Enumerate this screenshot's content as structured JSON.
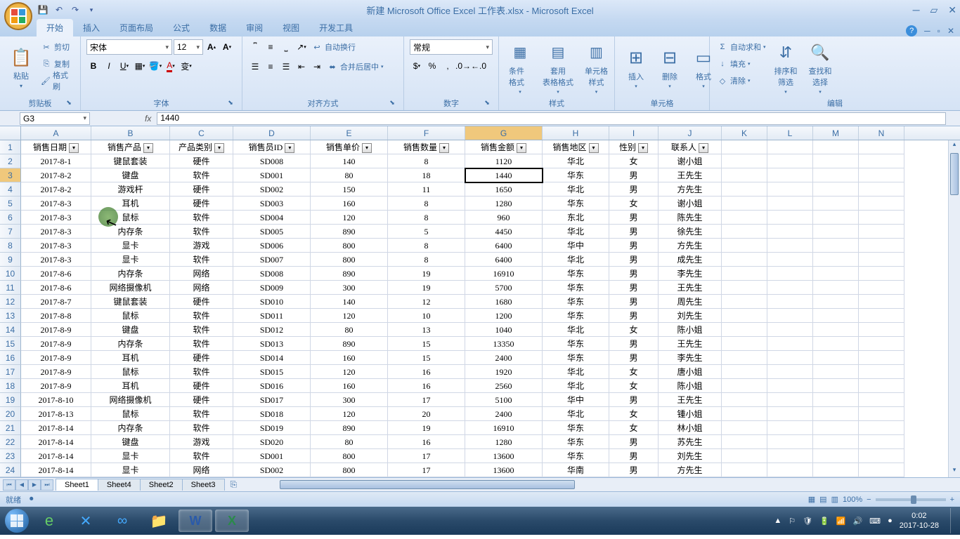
{
  "title": "新建 Microsoft Office Excel 工作表.xlsx - Microsoft Excel",
  "tabs": [
    "开始",
    "插入",
    "页面布局",
    "公式",
    "数据",
    "审阅",
    "视图",
    "开发工具"
  ],
  "activeTab": 0,
  "clipboard": {
    "label": "剪贴板",
    "paste": "粘贴",
    "cut": "剪切",
    "copy": "复制",
    "painter": "格式刷"
  },
  "font": {
    "label": "字体",
    "name": "宋体",
    "size": "12"
  },
  "align": {
    "label": "对齐方式",
    "wrap": "自动换行",
    "merge": "合并后居中"
  },
  "number": {
    "label": "数字",
    "format": "常规"
  },
  "styles": {
    "label": "样式",
    "cond": "条件格式",
    "table": "套用\n表格格式",
    "cell": "单元格\n样式"
  },
  "cells": {
    "label": "单元格",
    "insert": "插入",
    "delete": "删除",
    "format": "格式"
  },
  "editing": {
    "label": "编辑",
    "sum": "自动求和",
    "fill": "填充",
    "clear": "清除",
    "sort": "排序和\n筛选",
    "find": "查找和\n选择"
  },
  "nameBox": "G3",
  "formula": "1440",
  "columns": [
    "A",
    "B",
    "C",
    "D",
    "E",
    "F",
    "G",
    "H",
    "I",
    "J",
    "K",
    "L",
    "M",
    "N"
  ],
  "selectedCol": 6,
  "selectedRow": 3,
  "headers": [
    "销售日期",
    "销售产品",
    "产品类别",
    "销售员ID",
    "销售单价",
    "销售数量",
    "销售金额",
    "销售地区",
    "性别",
    "联系人"
  ],
  "rows": [
    [
      "2017-8-1",
      "键鼠套装",
      "硬件",
      "SD008",
      "140",
      "8",
      "1120",
      "华北",
      "女",
      "谢小姐"
    ],
    [
      "2017-8-2",
      "键盘",
      "软件",
      "SD001",
      "80",
      "18",
      "1440",
      "华东",
      "男",
      "王先生"
    ],
    [
      "2017-8-2",
      "游戏杆",
      "硬件",
      "SD002",
      "150",
      "11",
      "1650",
      "华北",
      "男",
      "方先生"
    ],
    [
      "2017-8-3",
      "耳机",
      "硬件",
      "SD003",
      "160",
      "8",
      "1280",
      "华东",
      "女",
      "谢小姐"
    ],
    [
      "2017-8-3",
      "鼠标",
      "软件",
      "SD004",
      "120",
      "8",
      "960",
      "东北",
      "男",
      "陈先生"
    ],
    [
      "2017-8-3",
      "内存条",
      "软件",
      "SD005",
      "890",
      "5",
      "4450",
      "华北",
      "男",
      "徐先生"
    ],
    [
      "2017-8-3",
      "显卡",
      "游戏",
      "SD006",
      "800",
      "8",
      "6400",
      "华中",
      "男",
      "方先生"
    ],
    [
      "2017-8-3",
      "显卡",
      "软件",
      "SD007",
      "800",
      "8",
      "6400",
      "华北",
      "男",
      "成先生"
    ],
    [
      "2017-8-6",
      "内存条",
      "网络",
      "SD008",
      "890",
      "19",
      "16910",
      "华东",
      "男",
      "李先生"
    ],
    [
      "2017-8-6",
      "网络摄像机",
      "网络",
      "SD009",
      "300",
      "19",
      "5700",
      "华东",
      "男",
      "王先生"
    ],
    [
      "2017-8-7",
      "键鼠套装",
      "硬件",
      "SD010",
      "140",
      "12",
      "1680",
      "华东",
      "男",
      "周先生"
    ],
    [
      "2017-8-8",
      "鼠标",
      "软件",
      "SD011",
      "120",
      "10",
      "1200",
      "华东",
      "男",
      "刘先生"
    ],
    [
      "2017-8-9",
      "键盘",
      "软件",
      "SD012",
      "80",
      "13",
      "1040",
      "华北",
      "女",
      "陈小姐"
    ],
    [
      "2017-8-9",
      "内存条",
      "软件",
      "SD013",
      "890",
      "15",
      "13350",
      "华东",
      "男",
      "王先生"
    ],
    [
      "2017-8-9",
      "耳机",
      "硬件",
      "SD014",
      "160",
      "15",
      "2400",
      "华东",
      "男",
      "李先生"
    ],
    [
      "2017-8-9",
      "鼠标",
      "软件",
      "SD015",
      "120",
      "16",
      "1920",
      "华北",
      "女",
      "唐小姐"
    ],
    [
      "2017-8-9",
      "耳机",
      "硬件",
      "SD016",
      "160",
      "16",
      "2560",
      "华北",
      "女",
      "陈小姐"
    ],
    [
      "2017-8-10",
      "网络摄像机",
      "硬件",
      "SD017",
      "300",
      "17",
      "5100",
      "华中",
      "男",
      "王先生"
    ],
    [
      "2017-8-13",
      "鼠标",
      "软件",
      "SD018",
      "120",
      "20",
      "2400",
      "华北",
      "女",
      "锺小姐"
    ],
    [
      "2017-8-14",
      "内存条",
      "软件",
      "SD019",
      "890",
      "19",
      "16910",
      "华东",
      "女",
      "林小姐"
    ],
    [
      "2017-8-14",
      "键盘",
      "游戏",
      "SD020",
      "80",
      "16",
      "1280",
      "华东",
      "男",
      "苏先生"
    ],
    [
      "2017-8-14",
      "显卡",
      "软件",
      "SD001",
      "800",
      "17",
      "13600",
      "华东",
      "男",
      "刘先生"
    ],
    [
      "2017-8-14",
      "显卡",
      "网络",
      "SD002",
      "800",
      "17",
      "13600",
      "华南",
      "男",
      "方先生"
    ]
  ],
  "sheets": [
    "Sheet1",
    "Sheet4",
    "Sheet2",
    "Sheet3"
  ],
  "activeSheet": 0,
  "status": "就绪",
  "zoom": "100%",
  "time": "0:02",
  "date": "2017-10-28"
}
